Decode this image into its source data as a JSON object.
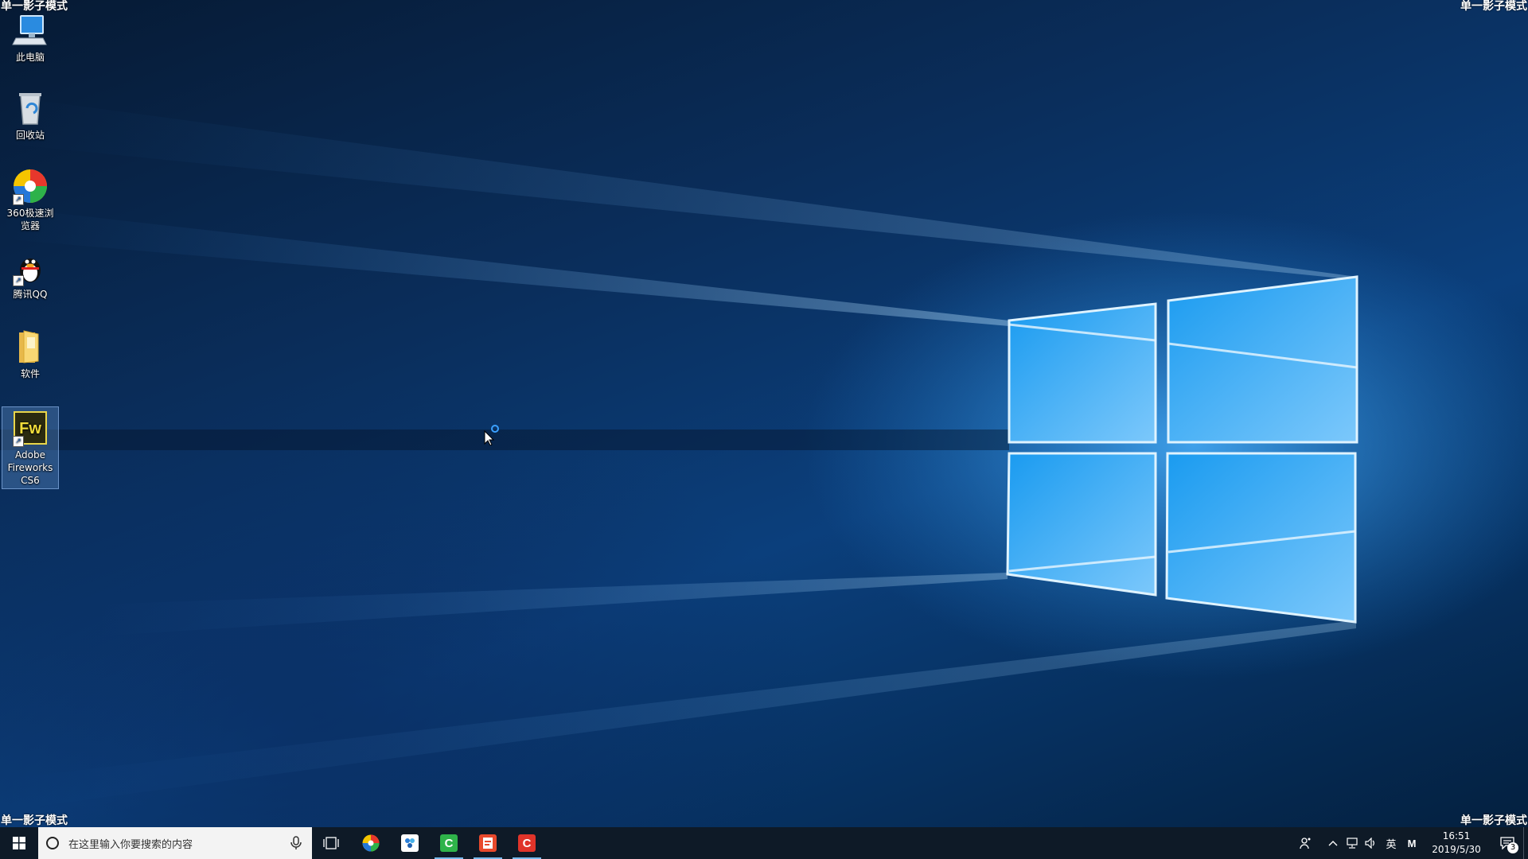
{
  "watermark": {
    "top_left": "单一影子模式",
    "top_right": "单一影子模式",
    "bottom_left": "单一影子模式",
    "bottom_right": "单一影子模式"
  },
  "desktop_icons": [
    {
      "label": "此电脑",
      "icon": "this-pc-icon"
    },
    {
      "label": "回收站",
      "icon": "recycle-bin-icon"
    },
    {
      "label": "360极速浏览器",
      "icon": "360-browser-icon"
    },
    {
      "label": "腾讯QQ",
      "icon": "qq-icon"
    },
    {
      "label": "软件",
      "icon": "folder-icon"
    },
    {
      "label": "Adobe Fireworks CS6",
      "icon": "fireworks-icon"
    }
  ],
  "fireworks_glyph_text": "Fw",
  "taskbar": {
    "search_placeholder": "在这里输入你要搜索的内容",
    "pins": [
      {
        "name": "360-browser",
        "running": false
      },
      {
        "name": "people-app",
        "running": false
      },
      {
        "name": "green-c-app",
        "letter": "C",
        "color": "#2fb34a",
        "running": true
      },
      {
        "name": "pdf-app",
        "color": "#e8492c",
        "running": true
      },
      {
        "name": "red-c-app",
        "letter": "C",
        "color": "#e0342a",
        "running": true
      }
    ],
    "tray": {
      "ime_label": "英",
      "ime_mode": "M",
      "time": "16:51",
      "date": "2019/5/30",
      "notification_count": "3"
    }
  },
  "colors": {
    "taskbar_bg": "#0e1a27",
    "running_indicator": "#76b9ed",
    "wallpaper_light": "#8fd0ff"
  }
}
